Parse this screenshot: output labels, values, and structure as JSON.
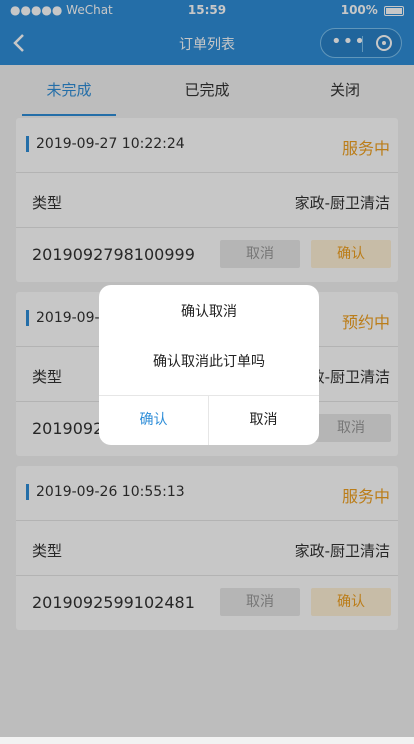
{
  "status_bar": {
    "carrier": "●●●●● WeChat",
    "time": "15:59",
    "battery": "100%"
  },
  "nav": {
    "title": "订单列表"
  },
  "tabs": [
    {
      "label": "未完成",
      "active": true
    },
    {
      "label": "已完成",
      "active": false
    },
    {
      "label": "关闭",
      "active": false
    }
  ],
  "orders": [
    {
      "date": "2019-09-27 10:22:24",
      "status": "服务中",
      "type_label": "类型",
      "type_value": "家政-厨卫清洁",
      "order_no": "2019092798100999",
      "cancel": "取消",
      "confirm": "确认"
    },
    {
      "date": "2019-09-26 ...",
      "status": "预约中",
      "type_label": "类型",
      "type_value": "家政-厨卫清洁",
      "order_no": "2019092...",
      "cancel": "取消",
      "confirm": ""
    },
    {
      "date": "2019-09-26 10:55:13",
      "status": "服务中",
      "type_label": "类型",
      "type_value": "家政-厨卫清洁",
      "order_no": "2019092599102481",
      "cancel": "取消",
      "confirm": "确认"
    }
  ],
  "dialog": {
    "title": "确认取消",
    "message": "确认取消此订单吗",
    "ok": "确认",
    "cancel": "取消"
  },
  "colors": {
    "primary": "#2f8ed8",
    "accent": "#f0a020"
  }
}
